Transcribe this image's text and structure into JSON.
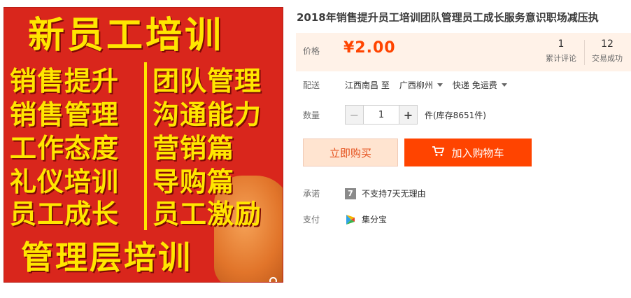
{
  "product_image": {
    "title": "新员工培训",
    "left_items": [
      "销售提升",
      "销售管理",
      "工作态度",
      "礼仪培训",
      "员工成长"
    ],
    "right_items": [
      "团队管理",
      "沟通能力",
      "营销篇",
      "导购篇",
      "员工激励"
    ],
    "bottom": "管理层培训",
    "zoom_icon": "search-icon"
  },
  "product": {
    "title": "2018年销售提升员工培训团队管理员工成长服务意识职场减压执"
  },
  "price": {
    "label": "价格",
    "value": "¥2.00",
    "stats": [
      {
        "num": "1",
        "label": "累计评论"
      },
      {
        "num": "12",
        "label": "交易成功"
      }
    ]
  },
  "shipping": {
    "label": "配送",
    "from": "江西南昌",
    "to_word": "至",
    "to": "广西柳州",
    "method": "快递 免运费"
  },
  "quantity": {
    "label": "数量",
    "minus": "−",
    "value": "1",
    "plus": "+",
    "stock": "件(库存8651件)"
  },
  "actions": {
    "buy_now": "立即购买",
    "add_to_cart": "加入购物车",
    "cart_icon": "cart-icon"
  },
  "promise": {
    "label": "承诺",
    "badge": "7",
    "text": "不支持7天无理由"
  },
  "payment": {
    "label": "支付",
    "method": "集分宝"
  },
  "colors": {
    "accent": "#ff4400",
    "price_bg": "#fff2e8",
    "image_bg": "#d9261c",
    "image_text": "#ffe600"
  }
}
